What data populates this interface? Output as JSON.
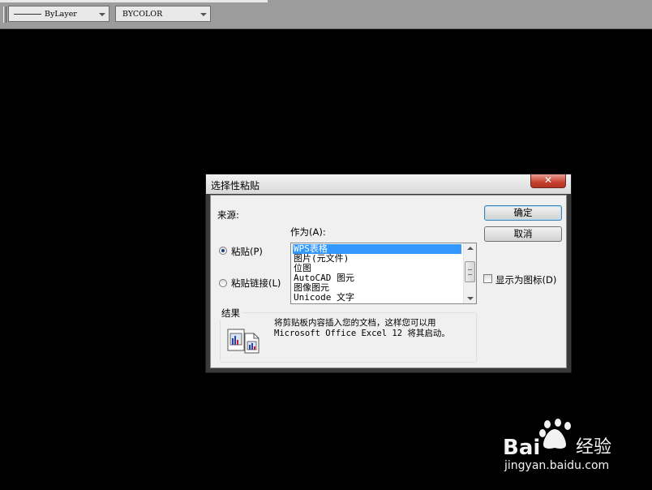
{
  "toolbar": {
    "linetype_value": "ByLayer",
    "color_value": "BYCOLOR"
  },
  "dialog": {
    "title": "选择性粘贴",
    "close_label": "✕",
    "source_label": "来源:",
    "as_label": "作为(A):",
    "paste_radio_label": "粘贴(P)",
    "paste_link_radio_label": "粘贴链接(L)",
    "paste_selected": true,
    "list_items": [
      "WPS表格",
      "图片(元文件)",
      "位图",
      "AutoCAD 图元",
      "图像图元",
      "Unicode 文字"
    ],
    "selected_index": 0,
    "ok_label": "确定",
    "cancel_label": "取消",
    "show_as_icon_label": "显示为图标(D)",
    "show_as_icon_checked": false,
    "result_title": "结果",
    "result_line1": "将剪贴板内容插入您的文档，这样您可以用",
    "result_line2": "Microsoft Office Excel 12 将其启动。"
  },
  "watermark": {
    "brand": "Bai 经验",
    "url": "jingyan.baidu.com"
  },
  "colors": {
    "canvas": "#000000",
    "selection": "#3399ff",
    "close": "#c6412f"
  }
}
